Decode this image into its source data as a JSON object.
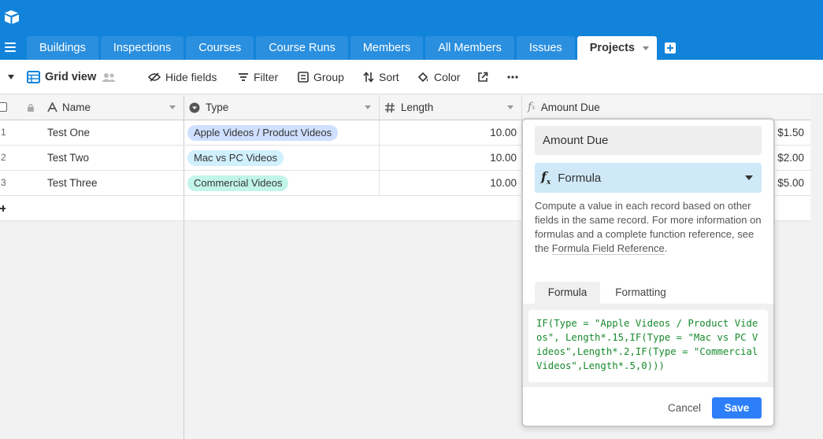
{
  "tabs": [
    {
      "label": "Buildings"
    },
    {
      "label": "Inspections"
    },
    {
      "label": "Courses"
    },
    {
      "label": "Course Runs"
    },
    {
      "label": "Members"
    },
    {
      "label": "All Members"
    },
    {
      "label": "Issues"
    },
    {
      "label": "Projects"
    }
  ],
  "viewbar": {
    "view_name": "Grid view",
    "hide_fields": "Hide fields",
    "filter": "Filter",
    "group": "Group",
    "sort": "Sort",
    "color": "Color"
  },
  "columns": {
    "name": "Name",
    "type": "Type",
    "length": "Length",
    "amount_due": "Amount Due"
  },
  "rows": [
    {
      "num": "1",
      "name": "Test One",
      "type": "Apple Videos / Product Videos",
      "type_color": "#cfdfff",
      "length": "10.00",
      "amount": "$1.50"
    },
    {
      "num": "2",
      "name": "Test Two",
      "type": "Mac vs PC Videos",
      "type_color": "#d0f0fd",
      "length": "10.00",
      "amount": "$2.00"
    },
    {
      "num": "3",
      "name": "Test Three",
      "type": "Commercial Videos",
      "type_color": "#c2f5e9",
      "length": "10.00",
      "amount": "$5.00"
    }
  ],
  "popover": {
    "field_name": "Amount Due",
    "field_type": "Formula",
    "description": "Compute a value in each record based on other fields in the same record. For more information on formulas and a complete function reference, see the ",
    "link_text": "Formula Field Reference",
    "description_end": ".",
    "tab_formula": "Formula",
    "tab_formatting": "Formatting",
    "formula": "IF(Type = \"Apple Videos / Product Videos\", Length*.15,IF(Type = \"Mac vs PC Videos\",Length*.2,IF(Type = \"Commercial Videos\",Length*.5,0)))",
    "cancel": "Cancel",
    "save": "Save"
  },
  "colors": {
    "brand": "#1283da",
    "save_button": "#2d7ff9",
    "formula_text": "#178a2c"
  }
}
